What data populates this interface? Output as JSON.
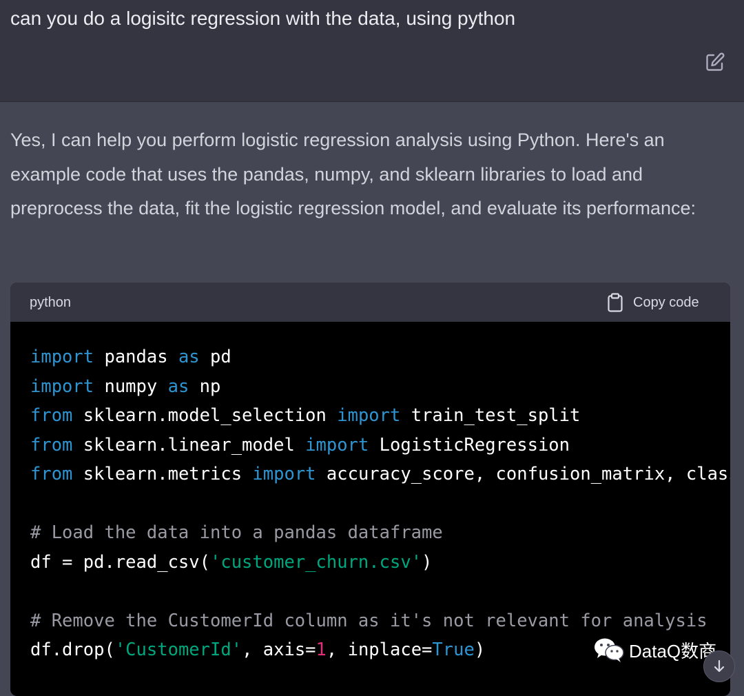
{
  "user_message": {
    "text": "can you do a logisitc regression with the data, using python",
    "edit_icon": "edit-icon"
  },
  "assistant_message": {
    "text": "Yes, I can help you perform logistic regression analysis using Python. Here's an example code that uses the pandas, numpy, and sklearn libraries to load and preprocess the data, fit the logistic regression model, and evaluate its performance:"
  },
  "code_block": {
    "language": "python",
    "copy_label": "Copy code",
    "copy_icon": "clipboard-icon",
    "lines": [
      [
        {
          "t": "kw",
          "v": "import"
        },
        {
          "t": "tx",
          "v": " pandas "
        },
        {
          "t": "kw",
          "v": "as"
        },
        {
          "t": "tx",
          "v": " pd"
        }
      ],
      [
        {
          "t": "kw",
          "v": "import"
        },
        {
          "t": "tx",
          "v": " numpy "
        },
        {
          "t": "kw",
          "v": "as"
        },
        {
          "t": "tx",
          "v": " np"
        }
      ],
      [
        {
          "t": "kw",
          "v": "from"
        },
        {
          "t": "tx",
          "v": " sklearn.model_selection "
        },
        {
          "t": "kw",
          "v": "import"
        },
        {
          "t": "tx",
          "v": " train_test_split"
        }
      ],
      [
        {
          "t": "kw",
          "v": "from"
        },
        {
          "t": "tx",
          "v": " sklearn.linear_model "
        },
        {
          "t": "kw",
          "v": "import"
        },
        {
          "t": "tx",
          "v": " LogisticRegression"
        }
      ],
      [
        {
          "t": "kw",
          "v": "from"
        },
        {
          "t": "tx",
          "v": " sklearn.metrics "
        },
        {
          "t": "kw",
          "v": "import"
        },
        {
          "t": "tx",
          "v": " accuracy_score, confusion_matrix, classi"
        }
      ],
      [],
      [
        {
          "t": "cm",
          "v": "# Load the data into a pandas dataframe"
        }
      ],
      [
        {
          "t": "tx",
          "v": "df = pd.read_csv("
        },
        {
          "t": "str",
          "v": "'customer_churn.csv'"
        },
        {
          "t": "tx",
          "v": ")"
        }
      ],
      [],
      [
        {
          "t": "cm",
          "v": "# Remove the CustomerId column as it's not relevant for analysis"
        }
      ],
      [
        {
          "t": "tx",
          "v": "df.drop("
        },
        {
          "t": "str",
          "v": "'CustomerId'"
        },
        {
          "t": "tx",
          "v": ", axis="
        },
        {
          "t": "num",
          "v": "1"
        },
        {
          "t": "tx",
          "v": ", inplace="
        },
        {
          "t": "bool",
          "v": "True"
        },
        {
          "t": "tx",
          "v": ")"
        }
      ]
    ]
  },
  "watermark": {
    "icon": "wechat-icon",
    "text": "DataQ数商"
  },
  "scroll_button": {
    "icon": "arrow-down-icon"
  },
  "colors": {
    "user_bg": "#343541",
    "assistant_bg": "#444654",
    "code_bg": "#000000",
    "keyword": "#2e95d3",
    "string": "#00a67d",
    "number": "#df3079",
    "comment": "#9a9aa5"
  }
}
